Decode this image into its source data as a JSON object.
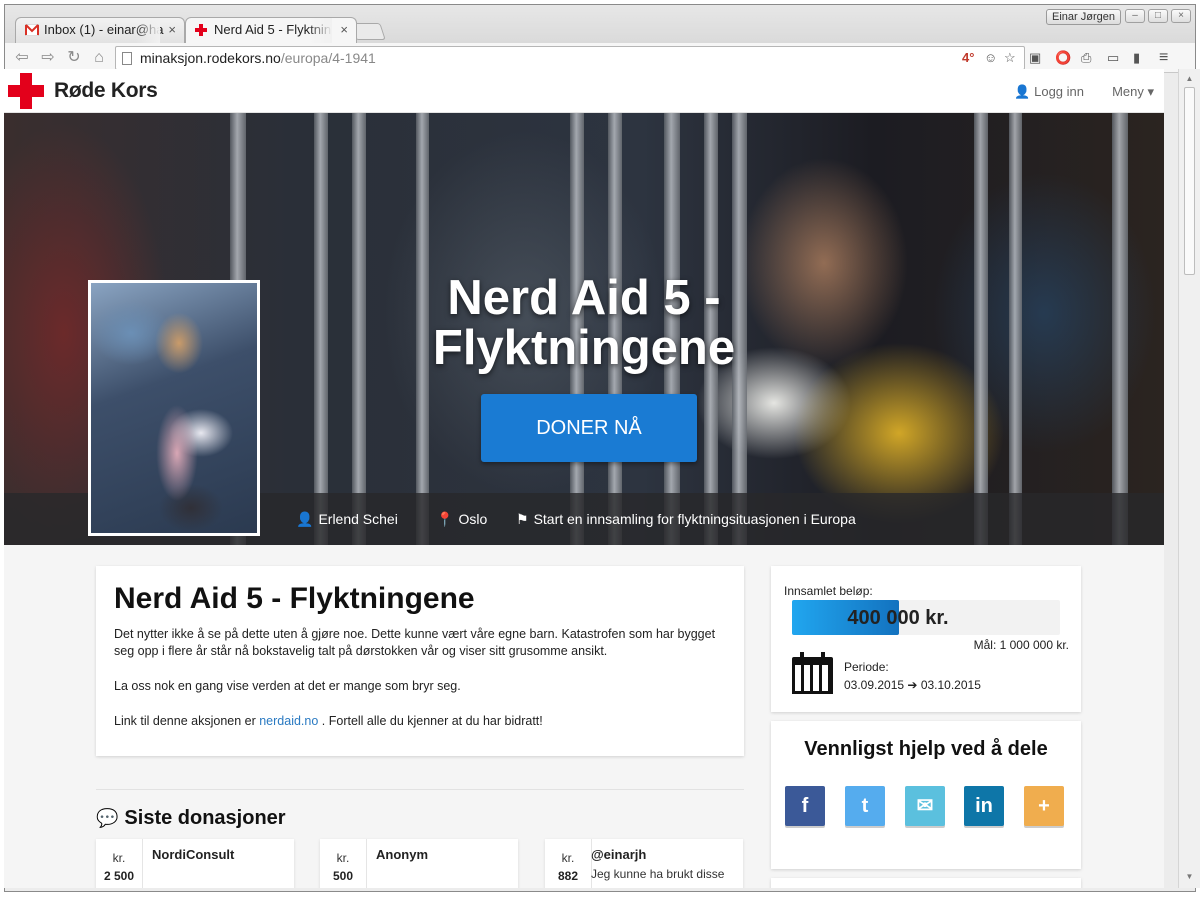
{
  "browser": {
    "tabs": [
      {
        "label": "Inbox (1) - einar@ha",
        "close": "×"
      },
      {
        "label": "Nerd Aid 5 - Flyktnin",
        "close": "×"
      }
    ],
    "profile_name": "Einar Jørgen",
    "window_buttons": [
      "–",
      "□",
      "×"
    ],
    "url_host": "minaksjon.rodekors.no",
    "url_path": "/europa/4-1941",
    "extension_badge": "4°"
  },
  "site": {
    "logo_text": "Røde Kors",
    "login_label": "Logg inn",
    "menu_label": "Meny ▾"
  },
  "hero": {
    "title": "Nerd Aid 5 - Flyktningene",
    "donate_label": "DONER NÅ",
    "owner": "Erlend Schei",
    "location": "Oslo",
    "campaign_link": "Start en innsamling for flyktningsituasjonen i Europa"
  },
  "story": {
    "title": "Nerd Aid 5 - Flyktningene",
    "p1": "Det nytter ikke å se på dette uten å gjøre noe. Dette kunne vært våre egne barn. Katastrofen som har bygget seg opp i flere år står nå bokstavelig talt på dørstokken vår og viser sitt grusomme ansikt.",
    "p2": "La oss nok en gang vise verden at det er mange som bryr seg.",
    "p3_before": "Link til denne aksjonen er ",
    "p3_link": "nerdaid.no",
    "p3_after": " . Fortell alle du kjenner at du har bidratt!"
  },
  "stats": {
    "collected_label": "Innsamlet beløp:",
    "collected_amount": "400 000 kr.",
    "progress_fraction": 0.4,
    "goal": "Mål: 1 000 000 kr.",
    "period_label": "Periode:",
    "start_date": "03.09.2015",
    "arrow": "➔",
    "end_date": "03.10.2015"
  },
  "share": {
    "title": "Vennligst hjelp ved å dele",
    "buttons": [
      {
        "icon": "f",
        "color": "#3b5998"
      },
      {
        "icon": "t",
        "color": "#55acee"
      },
      {
        "icon": "✉",
        "color": "#5bc0de"
      },
      {
        "icon": "in",
        "color": "#0e76a8"
      },
      {
        "icon": "+",
        "color": "#f0ad4e"
      }
    ]
  },
  "donations": {
    "title": "Siste donasjoner",
    "items": [
      {
        "currency": "kr.",
        "amount": "2 500",
        "name": "NordiConsult",
        "message": ""
      },
      {
        "currency": "kr.",
        "amount": "500",
        "name": "Anonym",
        "message": ""
      },
      {
        "currency": "kr.",
        "amount": "882",
        "name": "@einarjh",
        "message": "Jeg kunne ha brukt disse"
      }
    ]
  }
}
